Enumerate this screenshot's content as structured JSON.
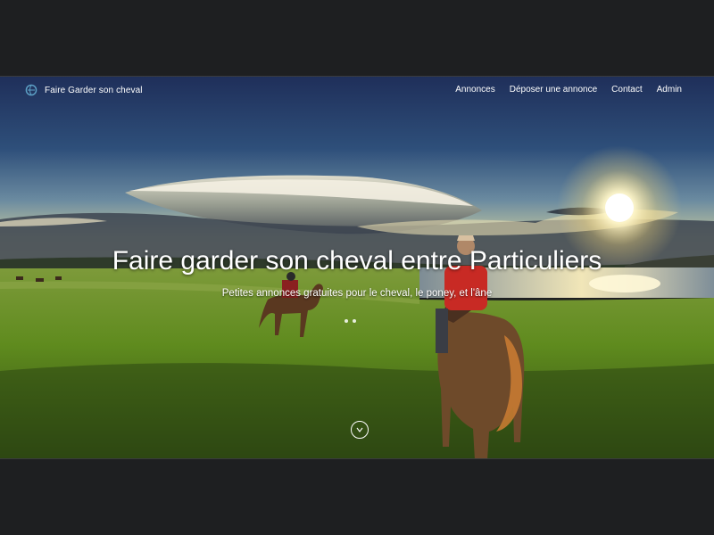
{
  "navbar": {
    "brand_text": "Faire Garder son cheval",
    "brand_icon": "globe-logo-icon",
    "links": [
      {
        "label": "Annonces"
      },
      {
        "label": "Déposer une annonce"
      },
      {
        "label": "Contact"
      },
      {
        "label": "Admin"
      }
    ]
  },
  "hero": {
    "title": "Faire garder son cheval entre Particuliers",
    "subtitle": "Petites annonces gratuites pour le cheval, le poney, et l'âne",
    "slides_count": 2,
    "scroll_icon": "chevron-down-icon"
  },
  "colors": {
    "page_background": "#1e1f21",
    "text": "#ffffff",
    "sky_top": "#1f2f5a",
    "grass": "#5f8b1e"
  }
}
